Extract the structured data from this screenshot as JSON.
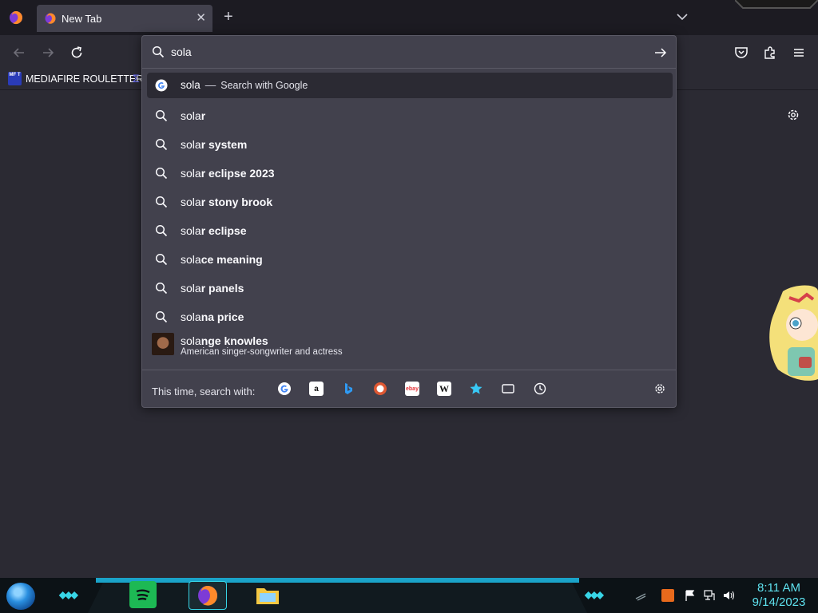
{
  "tabs": [
    {
      "title": "New Tab"
    }
  ],
  "urlbar": {
    "value": "sola",
    "suggestions": [
      {
        "typed": "sola",
        "action": "Search with Google",
        "type": "search-engine"
      },
      {
        "typed": "sola",
        "completion": "r",
        "type": "search"
      },
      {
        "typed": "sola",
        "completion": "r system",
        "type": "search"
      },
      {
        "typed": "sola",
        "completion": "r eclipse 2023",
        "type": "search"
      },
      {
        "typed": "sola",
        "completion": "r stony brook",
        "type": "search"
      },
      {
        "typed": "sola",
        "completion": "r eclipse",
        "type": "search"
      },
      {
        "typed": "sola",
        "completion": "ce meaning",
        "type": "search"
      },
      {
        "typed": "sola",
        "completion": "r panels",
        "type": "search"
      },
      {
        "typed": "sola",
        "completion": "na price",
        "type": "search"
      },
      {
        "typed": "sola",
        "completion": "nge knowles",
        "description": "American singer-songwriter and actress",
        "type": "rich"
      }
    ],
    "oneoff_label": "This time, search with:",
    "engines": [
      "google-icon",
      "amazon-icon",
      "bing-icon",
      "duckduckgo-icon",
      "ebay-icon",
      "wikipedia-icon",
      "bookmarks-icon",
      "tabs-icon",
      "history-icon"
    ]
  },
  "bookmarks": [
    {
      "label": "MEDIAFIRE ROULETTER",
      "logo": "MF T"
    }
  ],
  "taskbar": {
    "time": "8:11 AM",
    "date": "9/14/2023"
  },
  "colors": {
    "accent": "#38d5e6",
    "panel": "#42414d",
    "toolbar": "#2b2a33",
    "tabstrip": "#1c1b22"
  }
}
